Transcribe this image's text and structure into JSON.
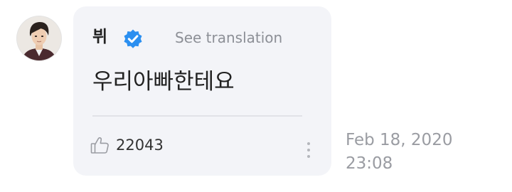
{
  "comment": {
    "author": "뷔",
    "avatar_icon": "user-avatar-photo",
    "verified_icon": "verified-badge-icon",
    "verified_color": "#2b8ff0",
    "see_translation": "See translation",
    "text": "우리아빠한테요",
    "like_icon": "thumbs-up-icon",
    "likes": "22043",
    "more_icon": "vertical-ellipsis-icon",
    "date": "Feb 18, 2020",
    "time": "23:08"
  },
  "colors": {
    "bubble_bg": "#f3f4f8",
    "muted_text": "#8c8f96",
    "primary_text": "#222222"
  }
}
